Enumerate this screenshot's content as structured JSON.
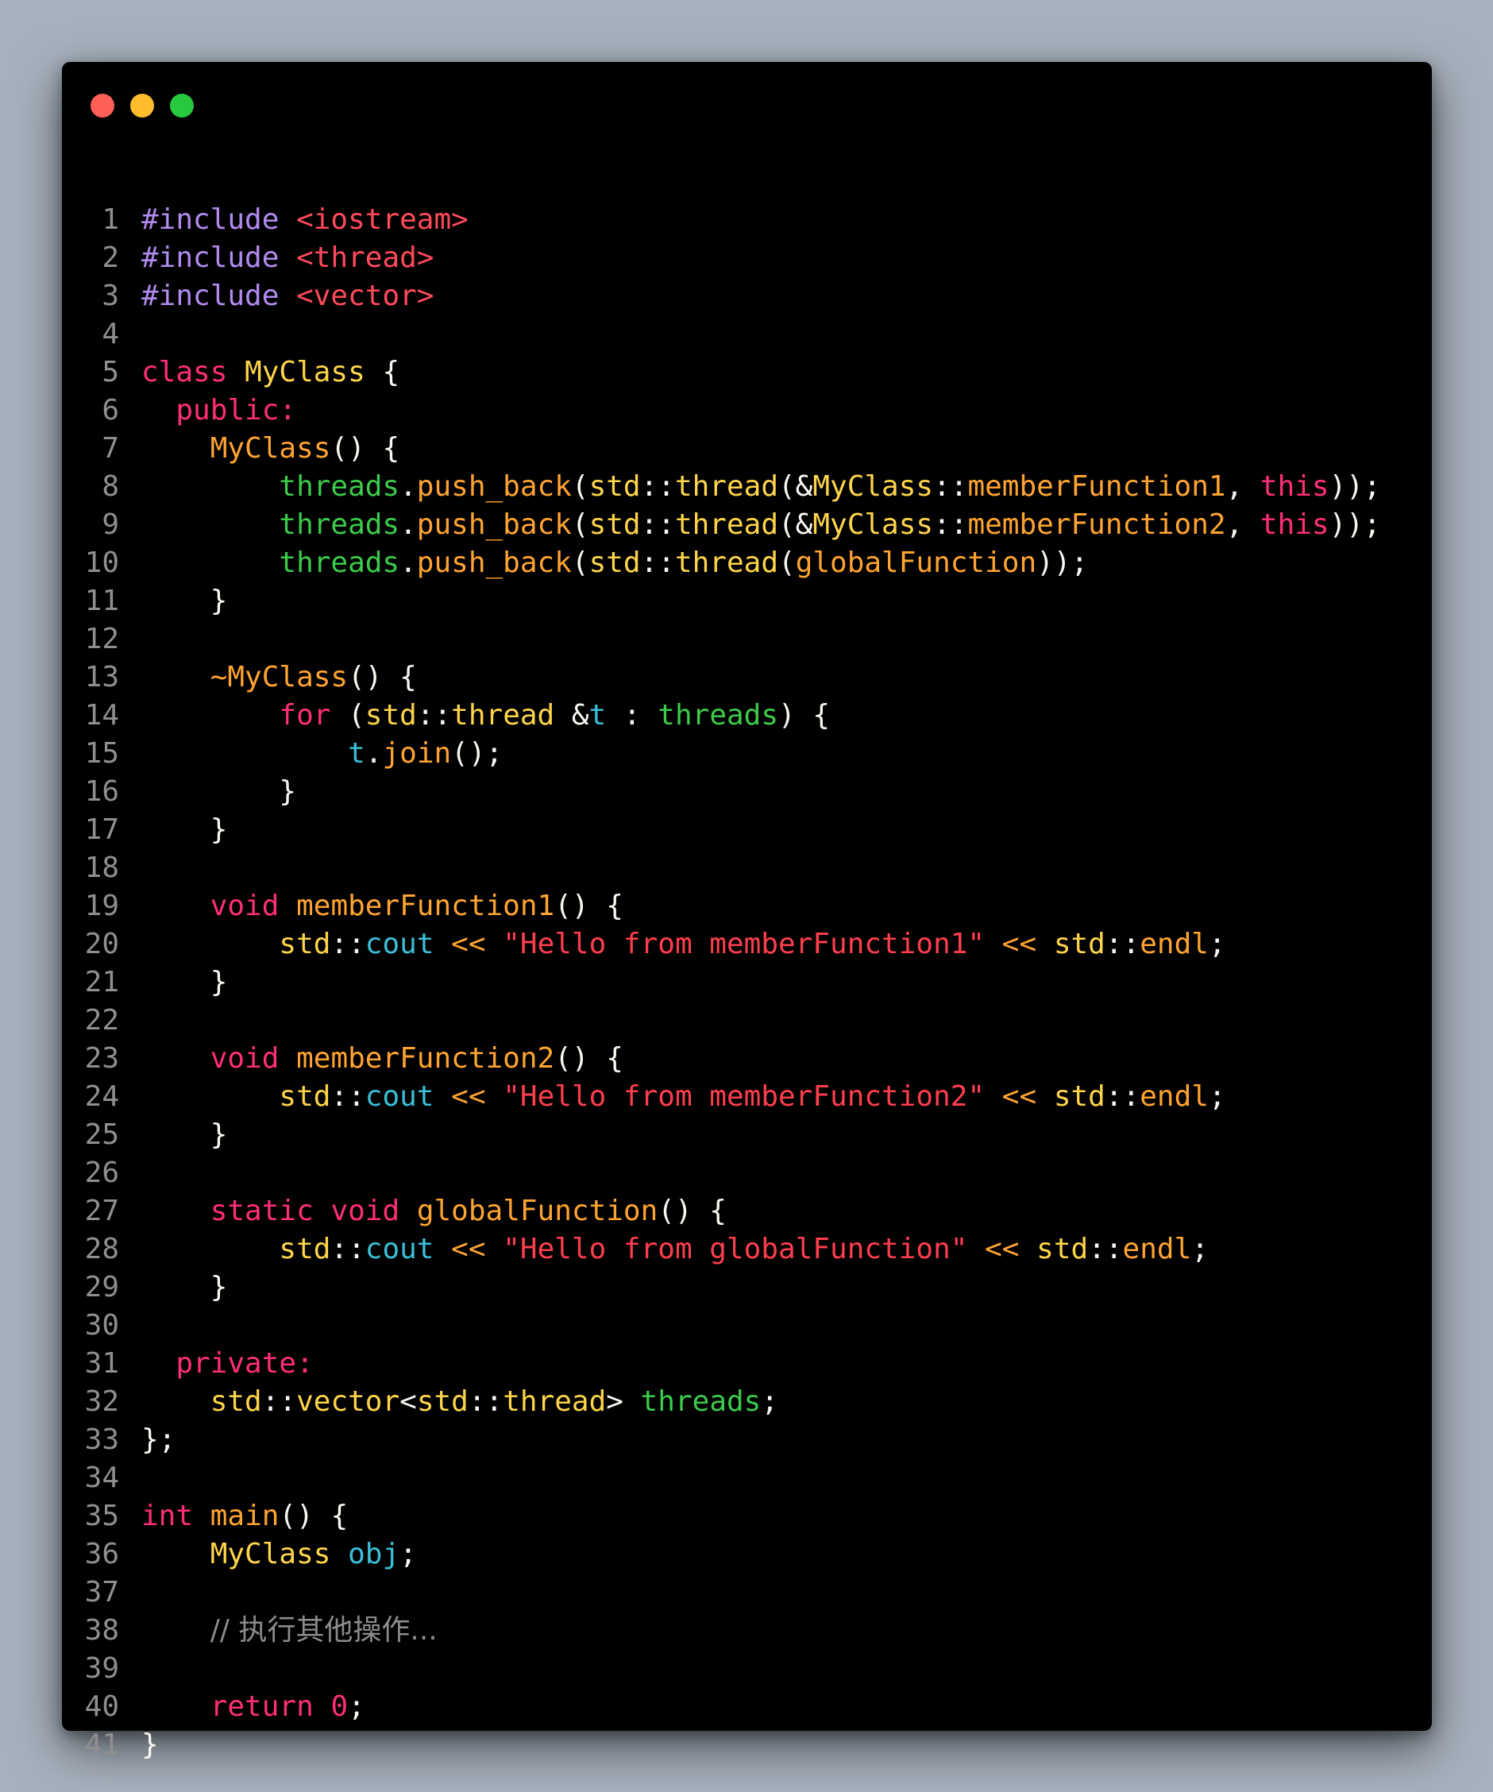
{
  "window": {
    "controls": [
      {
        "name": "close",
        "color": "#ff5f56"
      },
      {
        "name": "minimize",
        "color": "#ffbd2e"
      },
      {
        "name": "maximize",
        "color": "#27c93f"
      }
    ]
  },
  "code": {
    "language": "cpp",
    "lines": [
      [
        [
          "pre",
          "#include"
        ],
        [
          "pl",
          " "
        ],
        [
          "inc",
          "<iostream>"
        ]
      ],
      [
        [
          "pre",
          "#include"
        ],
        [
          "pl",
          " "
        ],
        [
          "inc",
          "<thread>"
        ]
      ],
      [
        [
          "pre",
          "#include"
        ],
        [
          "pl",
          " "
        ],
        [
          "inc",
          "<vector>"
        ]
      ],
      [],
      [
        [
          "kw",
          "class"
        ],
        [
          "pl",
          " "
        ],
        [
          "type",
          "MyClass"
        ],
        [
          "pl",
          " {"
        ]
      ],
      [
        [
          "pl",
          "  "
        ],
        [
          "kw",
          "public:"
        ]
      ],
      [
        [
          "pl",
          "    "
        ],
        [
          "fn",
          "MyClass"
        ],
        [
          "pl",
          "() {"
        ]
      ],
      [
        [
          "pl",
          "        "
        ],
        [
          "var",
          "threads"
        ],
        [
          "pl",
          "."
        ],
        [
          "fn",
          "push_back"
        ],
        [
          "pl",
          "("
        ],
        [
          "type",
          "std"
        ],
        [
          "pl",
          "::"
        ],
        [
          "type",
          "thread"
        ],
        [
          "pl",
          "(&"
        ],
        [
          "type",
          "MyClass"
        ],
        [
          "pl",
          "::"
        ],
        [
          "fn",
          "memberFunction1"
        ],
        [
          "pl",
          ", "
        ],
        [
          "kw",
          "this"
        ],
        [
          "pl",
          "));"
        ]
      ],
      [
        [
          "pl",
          "        "
        ],
        [
          "var",
          "threads"
        ],
        [
          "pl",
          "."
        ],
        [
          "fn",
          "push_back"
        ],
        [
          "pl",
          "("
        ],
        [
          "type",
          "std"
        ],
        [
          "pl",
          "::"
        ],
        [
          "type",
          "thread"
        ],
        [
          "pl",
          "(&"
        ],
        [
          "type",
          "MyClass"
        ],
        [
          "pl",
          "::"
        ],
        [
          "fn",
          "memberFunction2"
        ],
        [
          "pl",
          ", "
        ],
        [
          "kw",
          "this"
        ],
        [
          "pl",
          "));"
        ]
      ],
      [
        [
          "pl",
          "        "
        ],
        [
          "var",
          "threads"
        ],
        [
          "pl",
          "."
        ],
        [
          "fn",
          "push_back"
        ],
        [
          "pl",
          "("
        ],
        [
          "type",
          "std"
        ],
        [
          "pl",
          "::"
        ],
        [
          "type",
          "thread"
        ],
        [
          "pl",
          "("
        ],
        [
          "fn",
          "globalFunction"
        ],
        [
          "pl",
          "));"
        ]
      ],
      [
        [
          "pl",
          "    }"
        ]
      ],
      [],
      [
        [
          "pl",
          "    "
        ],
        [
          "fn",
          "~MyClass"
        ],
        [
          "pl",
          "() {"
        ]
      ],
      [
        [
          "pl",
          "        "
        ],
        [
          "kw",
          "for"
        ],
        [
          "pl",
          " ("
        ],
        [
          "type",
          "std"
        ],
        [
          "pl",
          "::"
        ],
        [
          "type",
          "thread"
        ],
        [
          "pl",
          " &"
        ],
        [
          "id",
          "t"
        ],
        [
          "pl",
          " : "
        ],
        [
          "var",
          "threads"
        ],
        [
          "pl",
          ") {"
        ]
      ],
      [
        [
          "pl",
          "            "
        ],
        [
          "id",
          "t"
        ],
        [
          "pl",
          "."
        ],
        [
          "fn",
          "join"
        ],
        [
          "pl",
          "();"
        ]
      ],
      [
        [
          "pl",
          "        }"
        ]
      ],
      [
        [
          "pl",
          "    }"
        ]
      ],
      [],
      [
        [
          "pl",
          "    "
        ],
        [
          "kw",
          "void"
        ],
        [
          "pl",
          " "
        ],
        [
          "fn",
          "memberFunction1"
        ],
        [
          "pl",
          "() {"
        ]
      ],
      [
        [
          "pl",
          "        "
        ],
        [
          "type",
          "std"
        ],
        [
          "pl",
          "::"
        ],
        [
          "id",
          "cout"
        ],
        [
          "pl",
          " "
        ],
        [
          "fn",
          "<<"
        ],
        [
          "pl",
          " "
        ],
        [
          "str",
          "\"Hello from memberFunction1\""
        ],
        [
          "pl",
          " "
        ],
        [
          "fn",
          "<<"
        ],
        [
          "pl",
          " "
        ],
        [
          "type",
          "std"
        ],
        [
          "pl",
          "::"
        ],
        [
          "fn",
          "endl"
        ],
        [
          "pl",
          ";"
        ]
      ],
      [
        [
          "pl",
          "    }"
        ]
      ],
      [],
      [
        [
          "pl",
          "    "
        ],
        [
          "kw",
          "void"
        ],
        [
          "pl",
          " "
        ],
        [
          "fn",
          "memberFunction2"
        ],
        [
          "pl",
          "() {"
        ]
      ],
      [
        [
          "pl",
          "        "
        ],
        [
          "type",
          "std"
        ],
        [
          "pl",
          "::"
        ],
        [
          "id",
          "cout"
        ],
        [
          "pl",
          " "
        ],
        [
          "fn",
          "<<"
        ],
        [
          "pl",
          " "
        ],
        [
          "str",
          "\"Hello from memberFunction2\""
        ],
        [
          "pl",
          " "
        ],
        [
          "fn",
          "<<"
        ],
        [
          "pl",
          " "
        ],
        [
          "type",
          "std"
        ],
        [
          "pl",
          "::"
        ],
        [
          "fn",
          "endl"
        ],
        [
          "pl",
          ";"
        ]
      ],
      [
        [
          "pl",
          "    }"
        ]
      ],
      [],
      [
        [
          "pl",
          "    "
        ],
        [
          "kw",
          "static"
        ],
        [
          "pl",
          " "
        ],
        [
          "kw",
          "void"
        ],
        [
          "pl",
          " "
        ],
        [
          "fn",
          "globalFunction"
        ],
        [
          "pl",
          "() {"
        ]
      ],
      [
        [
          "pl",
          "        "
        ],
        [
          "type",
          "std"
        ],
        [
          "pl",
          "::"
        ],
        [
          "id",
          "cout"
        ],
        [
          "pl",
          " "
        ],
        [
          "fn",
          "<<"
        ],
        [
          "pl",
          " "
        ],
        [
          "str",
          "\"Hello from globalFunction\""
        ],
        [
          "pl",
          " "
        ],
        [
          "fn",
          "<<"
        ],
        [
          "pl",
          " "
        ],
        [
          "type",
          "std"
        ],
        [
          "pl",
          "::"
        ],
        [
          "fn",
          "endl"
        ],
        [
          "pl",
          ";"
        ]
      ],
      [
        [
          "pl",
          "    }"
        ]
      ],
      [],
      [
        [
          "pl",
          "  "
        ],
        [
          "kw",
          "private:"
        ]
      ],
      [
        [
          "pl",
          "    "
        ],
        [
          "type",
          "std"
        ],
        [
          "pl",
          "::"
        ],
        [
          "type",
          "vector"
        ],
        [
          "pl",
          "<"
        ],
        [
          "type",
          "std"
        ],
        [
          "pl",
          "::"
        ],
        [
          "type",
          "thread"
        ],
        [
          "pl",
          "> "
        ],
        [
          "var",
          "threads"
        ],
        [
          "pl",
          ";"
        ]
      ],
      [
        [
          "pl",
          "};"
        ]
      ],
      [],
      [
        [
          "kw",
          "int"
        ],
        [
          "pl",
          " "
        ],
        [
          "fn",
          "main"
        ],
        [
          "pl",
          "() {"
        ]
      ],
      [
        [
          "pl",
          "    "
        ],
        [
          "type",
          "MyClass"
        ],
        [
          "pl",
          " "
        ],
        [
          "id",
          "obj"
        ],
        [
          "pl",
          ";"
        ]
      ],
      [],
      [
        [
          "pl",
          "    "
        ],
        [
          "cmt",
          "// 执行其他操作..."
        ]
      ],
      [],
      [
        [
          "pl",
          "    "
        ],
        [
          "kw",
          "return"
        ],
        [
          "pl",
          " "
        ],
        [
          "num",
          "0"
        ],
        [
          "pl",
          ";"
        ]
      ],
      [
        [
          "pl",
          "}"
        ]
      ]
    ]
  }
}
